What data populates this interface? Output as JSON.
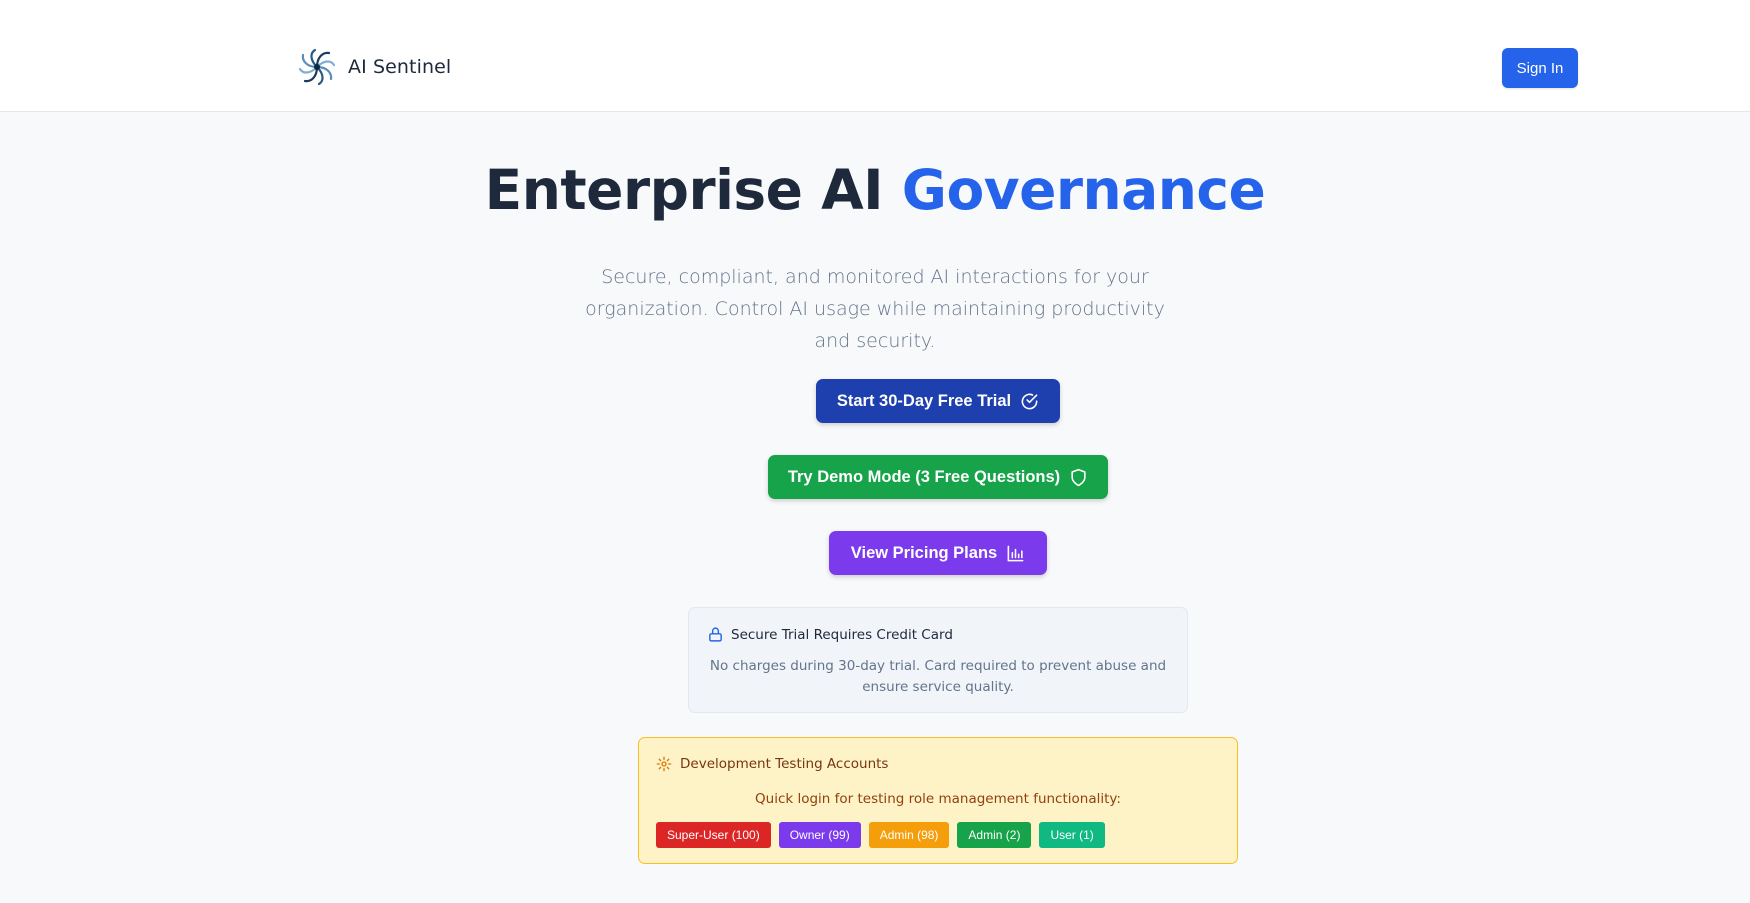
{
  "header": {
    "brand_name": "AI Sentinel",
    "signin_label": "Sign In"
  },
  "hero": {
    "title_main": "Enterprise AI ",
    "title_accent": "Governance",
    "subtitle": "Secure, compliant, and monitored AI interactions for your organization. Control AI usage while maintaining productivity and security."
  },
  "cta": {
    "trial_label": "Start 30-Day Free Trial",
    "demo_label": "Try Demo Mode (3 Free Questions)",
    "pricing_label": "View Pricing Plans"
  },
  "secure_notice": {
    "title": "Secure Trial Requires Credit Card",
    "text": "No charges during 30-day trial. Card required to prevent abuse and ensure service quality."
  },
  "dev_accounts": {
    "title": "Development Testing Accounts",
    "description": "Quick login for testing role management functionality:",
    "roles": [
      {
        "label": "Super-User (100)",
        "color": "#dc2626"
      },
      {
        "label": "Owner (99)",
        "color": "#7c3aed"
      },
      {
        "label": "Admin (98)",
        "color": "#f59e0b"
      },
      {
        "label": "Admin (2)",
        "color": "#16a34a"
      },
      {
        "label": "User (1)",
        "color": "#10b981"
      }
    ]
  },
  "icons": {
    "brand": "aperture-logo-icon",
    "trial": "check-circle-icon",
    "demo": "shield-icon",
    "pricing": "bar-chart-icon",
    "secure": "lock-icon",
    "dev": "gear-icon"
  },
  "colors": {
    "primary": "#2563eb",
    "trial_button": "#1e40af",
    "demo_button": "#16a34a",
    "pricing_button": "#7c3aed",
    "title_text": "#1e293b",
    "muted_text": "#64748b"
  }
}
